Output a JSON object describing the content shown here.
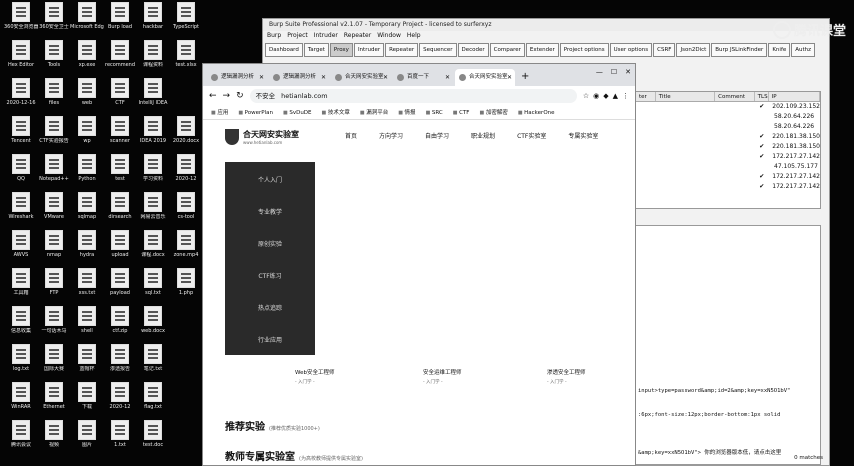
{
  "desktop": {
    "icons": [
      {
        "col": 0,
        "row": 0,
        "label": "360安全浏览器"
      },
      {
        "col": 1,
        "row": 0,
        "label": "360安全卫士"
      },
      {
        "col": 2,
        "row": 0,
        "label": "Microsoft Edge"
      },
      {
        "col": 3,
        "row": 0,
        "label": "Burp load"
      },
      {
        "col": 4,
        "row": 0,
        "label": "hackbar"
      },
      {
        "col": 5,
        "row": 0,
        "label": "TypeScript"
      },
      {
        "col": 0,
        "row": 1,
        "label": "Hex Editor"
      },
      {
        "col": 1,
        "row": 1,
        "label": "Tools"
      },
      {
        "col": 2,
        "row": 1,
        "label": "xp.exe"
      },
      {
        "col": 3,
        "row": 1,
        "label": "recommend"
      },
      {
        "col": 4,
        "row": 1,
        "label": "课程资料"
      },
      {
        "col": 5,
        "row": 1,
        "label": "test.xlsx"
      },
      {
        "col": 0,
        "row": 2,
        "label": "2020-12-16"
      },
      {
        "col": 1,
        "row": 2,
        "label": "files"
      },
      {
        "col": 2,
        "row": 2,
        "label": "web"
      },
      {
        "col": 3,
        "row": 2,
        "label": "CTF"
      },
      {
        "col": 4,
        "row": 2,
        "label": "IntelliJ IDEA"
      },
      {
        "col": 0,
        "row": 3,
        "label": "Tencent"
      },
      {
        "col": 1,
        "row": 3,
        "label": "CTF实验报告"
      },
      {
        "col": 2,
        "row": 3,
        "label": "wp"
      },
      {
        "col": 3,
        "row": 3,
        "label": "scanner"
      },
      {
        "col": 4,
        "row": 3,
        "label": "IDEA 2019"
      },
      {
        "col": 5,
        "row": 3,
        "label": "2020.docx"
      },
      {
        "col": 0,
        "row": 4,
        "label": "QQ"
      },
      {
        "col": 1,
        "row": 4,
        "label": "Notepad++"
      },
      {
        "col": 2,
        "row": 4,
        "label": "Python"
      },
      {
        "col": 3,
        "row": 4,
        "label": "test"
      },
      {
        "col": 4,
        "row": 4,
        "label": "学习资料"
      },
      {
        "col": 5,
        "row": 4,
        "label": "2020-12"
      },
      {
        "col": 0,
        "row": 5,
        "label": "Wireshark"
      },
      {
        "col": 1,
        "row": 5,
        "label": "VMware"
      },
      {
        "col": 2,
        "row": 5,
        "label": "sqlmap"
      },
      {
        "col": 3,
        "row": 5,
        "label": "dirsearch"
      },
      {
        "col": 4,
        "row": 5,
        "label": "网易云音乐"
      },
      {
        "col": 5,
        "row": 5,
        "label": "cs-tool"
      },
      {
        "col": 0,
        "row": 6,
        "label": "AWVS"
      },
      {
        "col": 1,
        "row": 6,
        "label": "nmap"
      },
      {
        "col": 2,
        "row": 6,
        "label": "hydra"
      },
      {
        "col": 3,
        "row": 6,
        "label": "upload"
      },
      {
        "col": 4,
        "row": 6,
        "label": "课程.docx"
      },
      {
        "col": 5,
        "row": 6,
        "label": "zone.mp4"
      },
      {
        "col": 0,
        "row": 7,
        "label": "工具箱"
      },
      {
        "col": 1,
        "row": 7,
        "label": "FTP"
      },
      {
        "col": 2,
        "row": 7,
        "label": "xss.txt"
      },
      {
        "col": 3,
        "row": 7,
        "label": "payload"
      },
      {
        "col": 4,
        "row": 7,
        "label": "sql.txt"
      },
      {
        "col": 5,
        "row": 7,
        "label": "1.php"
      },
      {
        "col": 0,
        "row": 8,
        "label": "信息收集"
      },
      {
        "col": 1,
        "row": 8,
        "label": "一句话木马"
      },
      {
        "col": 2,
        "row": 8,
        "label": "shell"
      },
      {
        "col": 3,
        "row": 8,
        "label": "ctf.zip"
      },
      {
        "col": 4,
        "row": 8,
        "label": "web.docx"
      },
      {
        "col": 0,
        "row": 9,
        "label": "log.txt"
      },
      {
        "col": 1,
        "row": 9,
        "label": "国际大赛"
      },
      {
        "col": 2,
        "row": 9,
        "label": "蓝帽杯"
      },
      {
        "col": 3,
        "row": 9,
        "label": "渗透报告"
      },
      {
        "col": 4,
        "row": 9,
        "label": "笔记.txt"
      },
      {
        "col": 0,
        "row": 10,
        "label": "WinRAR"
      },
      {
        "col": 1,
        "row": 10,
        "label": "Ethernet"
      },
      {
        "col": 2,
        "row": 10,
        "label": "下载"
      },
      {
        "col": 3,
        "row": 10,
        "label": "2020-12"
      },
      {
        "col": 4,
        "row": 10,
        "label": "flag.txt"
      },
      {
        "col": 0,
        "row": 11,
        "label": "腾讯会议"
      },
      {
        "col": 1,
        "row": 11,
        "label": "视频"
      },
      {
        "col": 2,
        "row": 11,
        "label": "图片"
      },
      {
        "col": 3,
        "row": 11,
        "label": "1.txt"
      },
      {
        "col": 4,
        "row": 11,
        "label": "test.doc"
      }
    ]
  },
  "watermark": {
    "text": "腾讯课堂"
  },
  "burp": {
    "title": "Burp Suite Professional v2.1.07 - Temporary Project - licensed to surferxyz",
    "menu": [
      "Burp",
      "Project",
      "Intruder",
      "Repeater",
      "Window",
      "Help"
    ],
    "tabs": [
      "Dashboard",
      "Target",
      "Proxy",
      "Intruder",
      "Repeater",
      "Sequencer",
      "Decoder",
      "Comparer",
      "Extender",
      "Project options",
      "User options",
      "CSRF",
      "Json2Dict",
      "Burp JSLinkFinder",
      "Knife",
      "Authz"
    ],
    "active_tab": "Proxy",
    "columns": [
      "ter",
      "Title",
      "Comment",
      "TLS",
      "IP"
    ],
    "rows": [
      {
        "tls": "✔",
        "ip": "202.109.23.152"
      },
      {
        "tls": "",
        "ip": "58.20.64.226"
      },
      {
        "tls": "",
        "ip": "58.20.64.226"
      },
      {
        "tls": "✔",
        "ip": "220.181.38.150"
      },
      {
        "tls": "✔",
        "ip": "220.181.38.150"
      },
      {
        "tls": "✔",
        "ip": "172.217.27.142"
      },
      {
        "tls": "",
        "ip": "47.105.75.177"
      },
      {
        "tls": "✔",
        "ip": "172.217.27.142"
      },
      {
        "tls": "✔",
        "ip": "172.217.27.142"
      }
    ],
    "code_lines": [
      "input>type=password&amp;id=2&amp;key=xxN5O1bV\"",
      ":6px;font-size:12px;border-bottom:1px solid",
      "&amp;key=xxN5O1bV\">    你的浏览器版本低，请点击这里"
    ],
    "matches": "0 matches"
  },
  "chrome": {
    "tabs": [
      {
        "label": "逻辑漏洞分析"
      },
      {
        "label": "逻辑漏洞分析"
      },
      {
        "label": "合天网安实验室"
      },
      {
        "label": "百度一下"
      },
      {
        "label": "合天网安实验室"
      }
    ],
    "active_tab_index": 4,
    "security_label": "不安全",
    "url": "hetianlab.com",
    "bookmarks": [
      "应用",
      "PowerPlan",
      "SvDuDE",
      "技术文章",
      "漏洞平台",
      "情报",
      "SRC",
      "CTF",
      "加密解密",
      "HackerOne"
    ],
    "page": {
      "brand": "合天网安实验室",
      "brand_sub": "www.hetianlab.com",
      "nav": [
        "首页",
        "方向学习",
        "自由学习",
        "职业规划",
        "CTF实验室",
        "专属实验室"
      ],
      "side_menu": [
        "个人入门",
        "专业教学",
        "原创实验",
        "CTF练习",
        "热点追踪",
        "行业应用"
      ],
      "jobs": [
        {
          "title": "Web安全工程师",
          "sub": "- 入门学 -"
        },
        {
          "title": "安全运维工程师",
          "sub": "- 入门学 -"
        },
        {
          "title": "渗透安全工程师",
          "sub": "- 入门学 -"
        }
      ],
      "section1": "推荐实验",
      "section1_sub": "(推荐优质实验1000+)",
      "section2": "教师专属实验室",
      "section2_sub": "(为高校教师提供专属实验室)"
    }
  }
}
